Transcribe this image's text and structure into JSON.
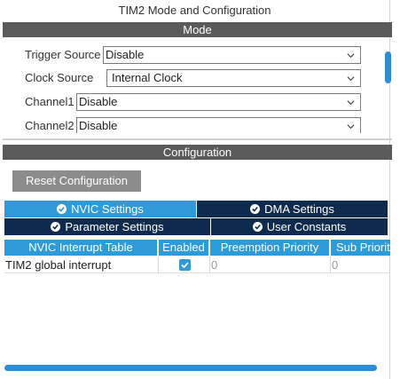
{
  "window": {
    "title": "TIM2 Mode and Configuration"
  },
  "mode": {
    "header": "Mode",
    "fields": [
      {
        "label": "Trigger Source",
        "value": "Disable"
      },
      {
        "label": "Clock Source",
        "value": "Internal Clock"
      },
      {
        "label": "Channel1",
        "value": "Disable"
      },
      {
        "label": "Channel2",
        "value": "Disable"
      }
    ]
  },
  "configuration": {
    "header": "Configuration",
    "reset_label": "Reset Configuration",
    "tabs": [
      {
        "label": "NVIC Settings",
        "active": true
      },
      {
        "label": "DMA Settings",
        "active": false
      },
      {
        "label": "Parameter Settings",
        "active": false
      },
      {
        "label": "User Constants",
        "active": false
      }
    ],
    "table": {
      "columns": [
        "NVIC Interrupt Table",
        "Enabled",
        "Preemption Priority",
        "Sub Priorit"
      ],
      "rows": [
        {
          "name": "TIM2 global interrupt",
          "enabled": true,
          "preemption": "0",
          "sub": "0"
        }
      ]
    }
  },
  "colors": {
    "accent": "#2f9ad8",
    "tab_inactive": "#0e2a4d",
    "section_bar": "#5a5a5a",
    "button": "#8c8c8c"
  },
  "icons": {
    "dropdown": "chevron-down-icon",
    "tab_status": "check-circle-icon",
    "checkbox": "check-icon"
  }
}
